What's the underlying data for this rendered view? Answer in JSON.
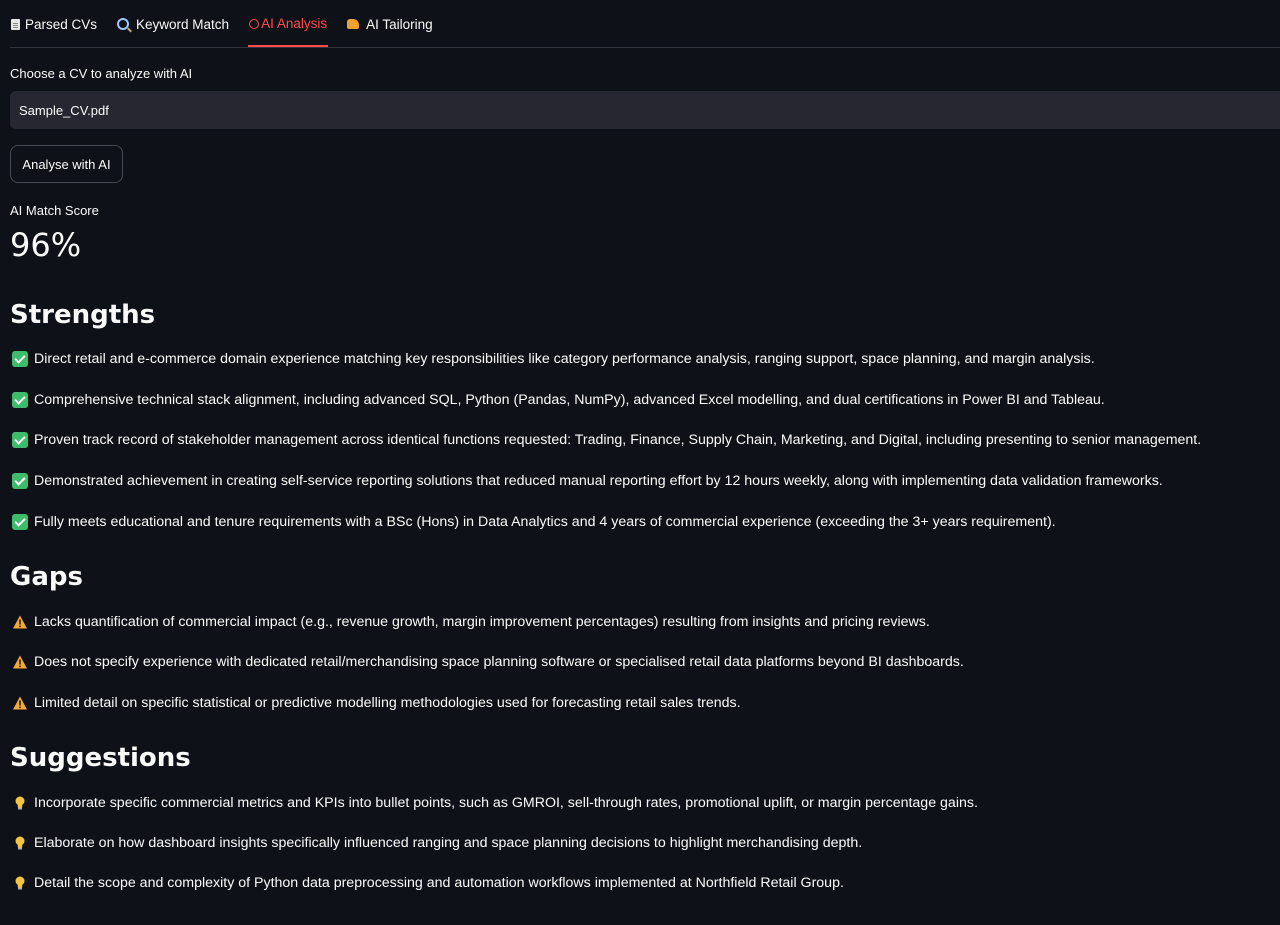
{
  "tabs": [
    {
      "label": "Parsed CVs",
      "icon": "document-icon",
      "active": false
    },
    {
      "label": "Keyword Match",
      "icon": "magnifier-icon",
      "active": false
    },
    {
      "label": "AI Analysis",
      "icon": "robot-icon",
      "active": true
    },
    {
      "label": "AI Tailoring",
      "icon": "writing-hand-icon",
      "active": false
    }
  ],
  "select": {
    "label": "Choose a CV to analyze with AI",
    "value": "Sample_CV.pdf"
  },
  "analyse_button": "Analyse with AI",
  "metric": {
    "label": "AI Match Score",
    "value": "96%"
  },
  "strengths": {
    "heading": "Strengths",
    "items": [
      "Direct retail and e-commerce domain experience matching key responsibilities like category performance analysis, ranging support, space planning, and margin analysis.",
      "Comprehensive technical stack alignment, including advanced SQL, Python (Pandas, NumPy), advanced Excel modelling, and dual certifications in Power BI and Tableau.",
      "Proven track record of stakeholder management across identical functions requested: Trading, Finance, Supply Chain, Marketing, and Digital, including presenting to senior management.",
      "Demonstrated achievement in creating self-service reporting solutions that reduced manual reporting effort by 12 hours weekly, along with implementing data validation frameworks.",
      "Fully meets educational and tenure requirements with a BSc (Hons) in Data Analytics and 4 years of commercial experience (exceeding the 3+ years requirement)."
    ]
  },
  "gaps": {
    "heading": "Gaps",
    "items": [
      "Lacks quantification of commercial impact (e.g., revenue growth, margin improvement percentages) resulting from insights and pricing reviews.",
      "Does not specify experience with dedicated retail/merchandising space planning software or specialised retail data platforms beyond BI dashboards.",
      "Limited detail on specific statistical or predictive modelling methodologies used for forecasting retail sales trends."
    ]
  },
  "suggestions": {
    "heading": "Suggestions",
    "items": [
      "Incorporate specific commercial metrics and KPIs into bullet points, such as GMROI, sell-through rates, promotional uplift, or margin percentage gains.",
      "Elaborate on how dashboard insights specifically influenced ranging and space planning decisions to highlight merchandising depth.",
      "Detail the scope and complexity of Python data preprocessing and automation workflows implemented at Northfield Retail Group."
    ]
  },
  "colors": {
    "background": "#0e1117",
    "accent": "#ff4b4b",
    "check": "#3dbd6b",
    "warning": "#f2a93b",
    "bulb": "#f5c542"
  }
}
